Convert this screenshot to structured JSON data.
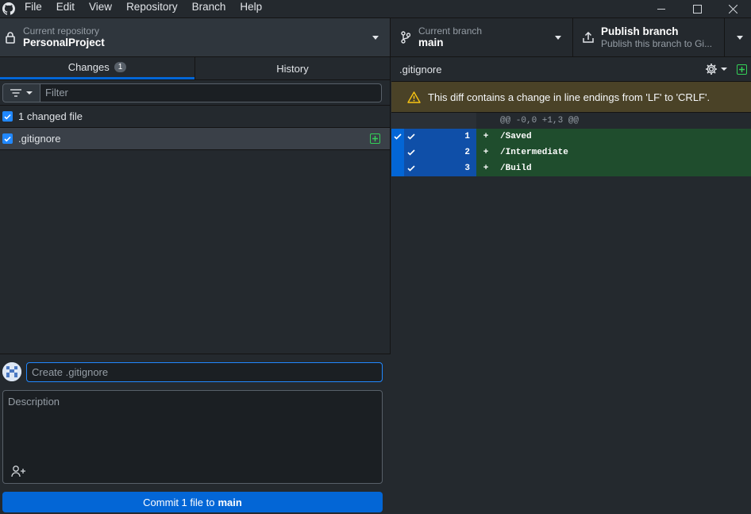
{
  "menu": {
    "items": [
      "File",
      "Edit",
      "View",
      "Repository",
      "Branch",
      "Help"
    ]
  },
  "toolbar": {
    "repo_label": "Current repository",
    "repo_name": "PersonalProject",
    "branch_label": "Current branch",
    "branch_name": "main",
    "publish_title": "Publish branch",
    "publish_sub": "Publish this branch to Gi..."
  },
  "tabs": {
    "changes_label": "Changes",
    "changes_count": "1",
    "history_label": "History"
  },
  "filter": {
    "placeholder": "Filter"
  },
  "changes": {
    "header": "1 changed file",
    "files": [
      ".gitignore"
    ]
  },
  "commit": {
    "summary_placeholder": "Create .gitignore",
    "description_placeholder": "Description",
    "button_prefix": "Commit 1 file to",
    "button_branch": "main"
  },
  "diff": {
    "filename": ".gitignore",
    "warning": "This diff contains a change in line endings from 'LF' to 'CRLF'.",
    "hunk": "@@ -0,0 +1,3 @@",
    "lines": [
      {
        "num": "1",
        "sign": "+",
        "text": "/Saved"
      },
      {
        "num": "2",
        "sign": "+",
        "text": "/Intermediate"
      },
      {
        "num": "3",
        "sign": "+",
        "text": "/Build"
      }
    ]
  },
  "colors": {
    "accent": "#0366d6",
    "added": "#34d058",
    "warning_bg": "#4a4227"
  }
}
